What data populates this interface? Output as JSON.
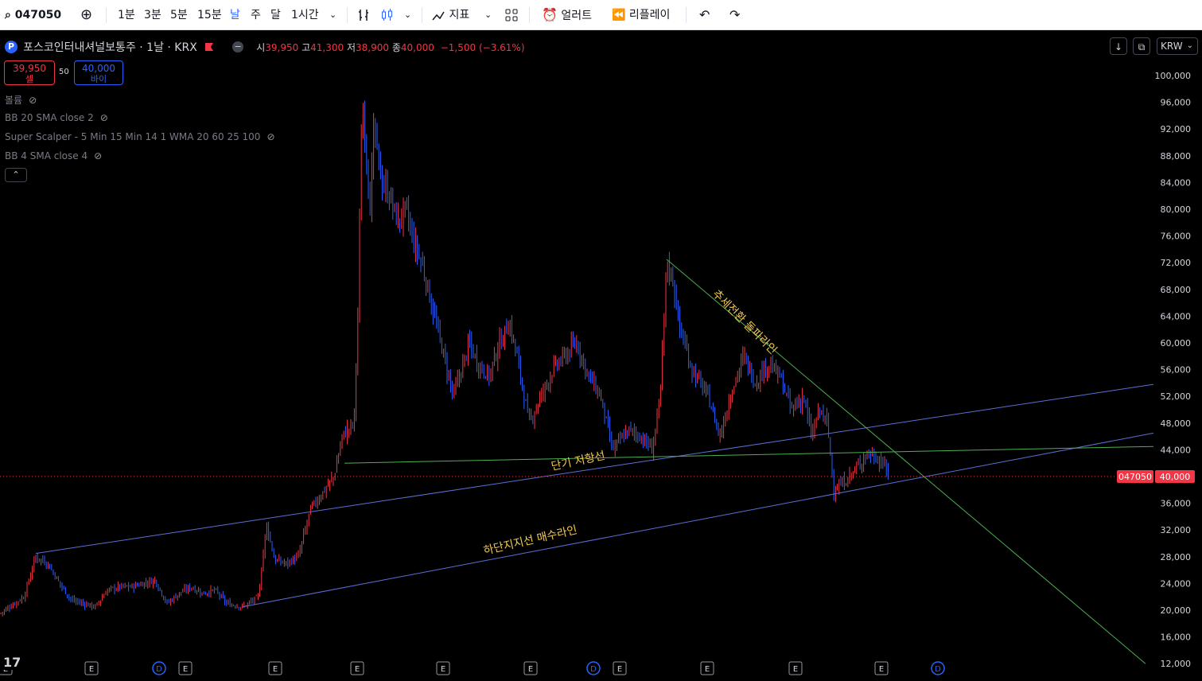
{
  "toolbar": {
    "symbol": "047050",
    "intervals": [
      "1분",
      "3분",
      "5분",
      "15분",
      "날",
      "주",
      "달",
      "1시간"
    ],
    "active_interval": "날",
    "indicators_label": "지표",
    "alert_label": "얼러트",
    "replay_label": "리플레이"
  },
  "header": {
    "title": "포스코인터내셔널보통주 · 1날 · KRX",
    "logo_letter": "P",
    "open_label": "시",
    "open": "39,950",
    "high_label": "고",
    "high": "41,300",
    "low_label": "저",
    "low": "38,900",
    "close_label": "종",
    "close": "40,000",
    "change": "−1,500 (−3.61%)",
    "currency": "KRW"
  },
  "trade": {
    "sell_price": "39,950",
    "sell_label": "셀",
    "spread": "50",
    "buy_price": "40,000",
    "buy_label": "바이"
  },
  "indicators": [
    "볼륨",
    "BB 20 SMA close 2",
    "Super Scalper - 5 Min 15 Min 14 1 WMA 20 60 25 100",
    "BB 4 SMA close 4"
  ],
  "colors": {
    "up": "#f23645",
    "down": "#2962ff",
    "blue_line": "#5b6fd6",
    "green_line": "#4caf50",
    "annotation": "#f2c94c"
  },
  "chart_data": {
    "type": "candlestick",
    "price_axis": [
      "100,000",
      "96,000",
      "92,000",
      "88,000",
      "84,000",
      "80,000",
      "76,000",
      "72,000",
      "68,000",
      "64,000",
      "60,000",
      "56,000",
      "52,000",
      "48,000",
      "44,000",
      "40,000",
      "36,000",
      "32,000",
      "28,000",
      "24,000",
      "20,000",
      "16,000",
      "12,000"
    ],
    "last_price": 40000,
    "last_price_label": "40,000",
    "symbol_tag": "047050",
    "ylim": [
      10000,
      104000
    ],
    "event_markers": [
      "E",
      "E",
      "D",
      "E",
      "E",
      "E",
      "E",
      "E",
      "D",
      "E",
      "E",
      "E",
      "E",
      "D"
    ],
    "close_path": [
      [
        0,
        19500
      ],
      [
        30,
        22000
      ],
      [
        45,
        28000
      ],
      [
        60,
        27000
      ],
      [
        75,
        24000
      ],
      [
        90,
        21500
      ],
      [
        105,
        21000
      ],
      [
        120,
        20500
      ],
      [
        135,
        23000
      ],
      [
        150,
        23500
      ],
      [
        165,
        23500
      ],
      [
        180,
        24000
      ],
      [
        195,
        24500
      ],
      [
        210,
        21000
      ],
      [
        225,
        22500
      ],
      [
        240,
        23500
      ],
      [
        255,
        22500
      ],
      [
        270,
        23000
      ],
      [
        285,
        21000
      ],
      [
        305,
        20500
      ],
      [
        325,
        22000
      ],
      [
        335,
        33000
      ],
      [
        345,
        27500
      ],
      [
        360,
        27000
      ],
      [
        375,
        28000
      ],
      [
        390,
        35000
      ],
      [
        405,
        37500
      ],
      [
        420,
        40000
      ],
      [
        430,
        46000
      ],
      [
        445,
        48000
      ],
      [
        450,
        65000
      ],
      [
        455,
        96000
      ],
      [
        460,
        90000
      ],
      [
        465,
        80000
      ],
      [
        470,
        92000
      ],
      [
        480,
        84000
      ],
      [
        490,
        82000
      ],
      [
        500,
        78000
      ],
      [
        510,
        80000
      ],
      [
        520,
        75000
      ],
      [
        530,
        72000
      ],
      [
        540,
        67000
      ],
      [
        550,
        62000
      ],
      [
        560,
        57000
      ],
      [
        570,
        52000
      ],
      [
        580,
        56000
      ],
      [
        590,
        60000
      ],
      [
        600,
        57000
      ],
      [
        615,
        55000
      ],
      [
        625,
        59000
      ],
      [
        640,
        63000
      ],
      [
        650,
        58000
      ],
      [
        665,
        48000
      ],
      [
        680,
        52000
      ],
      [
        695,
        56000
      ],
      [
        710,
        58000
      ],
      [
        725,
        60000
      ],
      [
        740,
        55000
      ],
      [
        755,
        52000
      ],
      [
        770,
        44000
      ],
      [
        790,
        47000
      ],
      [
        805,
        46000
      ],
      [
        820,
        44000
      ],
      [
        830,
        52000
      ],
      [
        838,
        72000
      ],
      [
        845,
        70000
      ],
      [
        855,
        62000
      ],
      [
        870,
        56000
      ],
      [
        890,
        52000
      ],
      [
        905,
        46000
      ],
      [
        920,
        53000
      ],
      [
        935,
        58000
      ],
      [
        950,
        54000
      ],
      [
        965,
        57000
      ],
      [
        980,
        55000
      ],
      [
        995,
        50000
      ],
      [
        1010,
        52000
      ],
      [
        1020,
        46000
      ],
      [
        1030,
        50000
      ],
      [
        1040,
        48000
      ],
      [
        1048,
        38000
      ],
      [
        1060,
        39000
      ],
      [
        1075,
        41000
      ],
      [
        1090,
        43500
      ],
      [
        1100,
        43000
      ],
      [
        1110,
        42000
      ],
      [
        1117,
        40000
      ]
    ],
    "trendlines": [
      {
        "name": "하단지지선 매수라인",
        "color": "blue",
        "from": [
          305,
          20500
        ],
        "to": [
          1450,
          46500
        ]
      },
      {
        "name": "",
        "color": "blue",
        "from": [
          45,
          28500
        ],
        "to": [
          1450,
          53800
        ]
      },
      {
        "name": "단기 저항선",
        "color": "green",
        "from": [
          433,
          42000
        ],
        "to": [
          1450,
          44500
        ]
      },
      {
        "name": "추세전환 돌파라인",
        "color": "green",
        "from": [
          838,
          72500
        ],
        "to": [
          1440,
          12000
        ]
      }
    ],
    "annotations": [
      "추세전환 돌파라인",
      "단기 저항선",
      "하단지지선 매수라인"
    ]
  }
}
